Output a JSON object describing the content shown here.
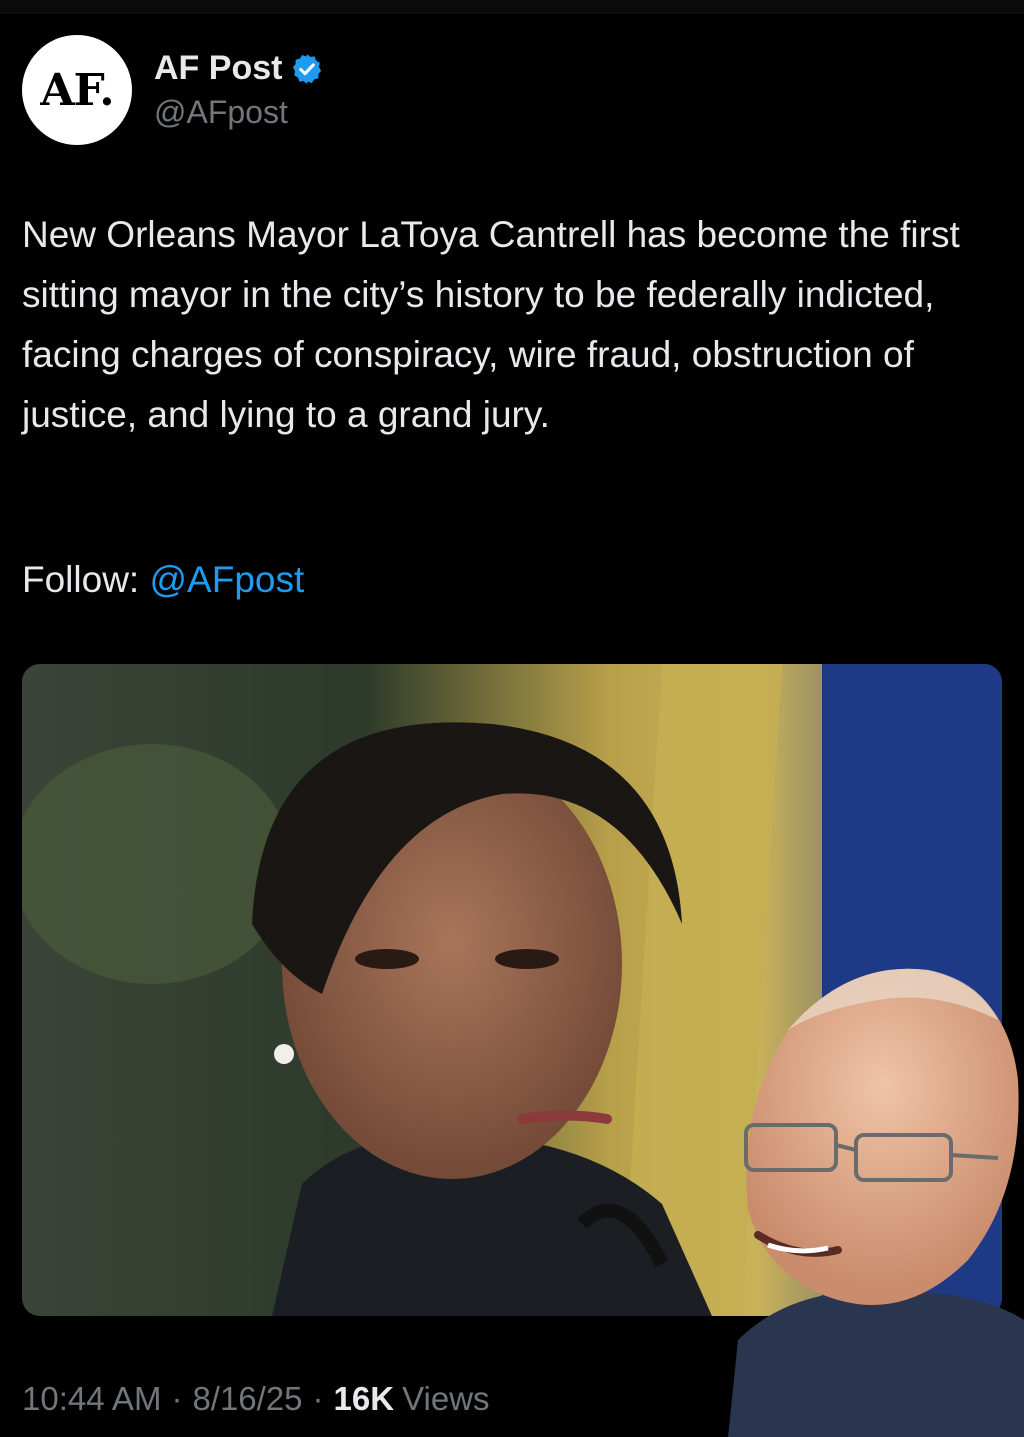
{
  "account": {
    "avatar_text": "AF.",
    "display_name": "AF Post",
    "handle": "@AFpost",
    "verified_icon": "verified-badge-icon"
  },
  "tweet": {
    "text": "New Orleans Mayor LaToya Cantrell has become the first sitting mayor in the city’s history to be federally indicted, facing charges of conspiracy, wire fraud, obstruction of justice, and lying to a grand jury.",
    "follow_label": "Follow:",
    "follow_mention": "@AFpost"
  },
  "meta": {
    "time": "10:44 AM",
    "date": "8/16/25",
    "views_count": "16K",
    "views_label": "Views",
    "separator": "·"
  },
  "colors": {
    "background": "#000000",
    "text": "#e7e9ea",
    "muted": "#71767b",
    "accent": "#1d9bf0"
  }
}
